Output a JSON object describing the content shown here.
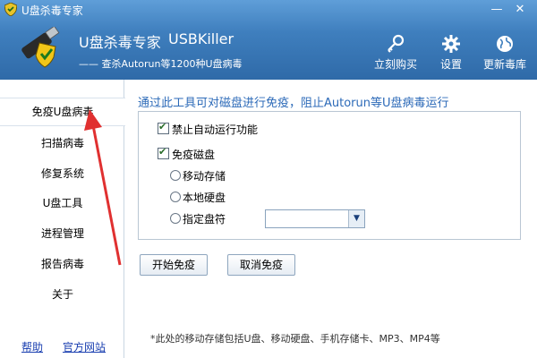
{
  "window": {
    "title": "U盘杀毒专家",
    "minimize": "—",
    "close": "✕"
  },
  "header": {
    "app_name": "U盘杀毒专家",
    "app_name_en": "USBKiller",
    "tagline": "—— 查杀Autorun等1200种U盘病毒",
    "tools": [
      {
        "label": "立刻购买",
        "icon": "key-icon"
      },
      {
        "label": "设置",
        "icon": "gear-icon"
      },
      {
        "label": "更新毒库",
        "icon": "globe-icon"
      }
    ]
  },
  "sidebar": {
    "items": [
      {
        "label": "免疫U盘病毒",
        "selected": true
      },
      {
        "label": "扫描病毒"
      },
      {
        "label": "修复系统"
      },
      {
        "label": "U盘工具"
      },
      {
        "label": "进程管理"
      },
      {
        "label": "报告病毒"
      },
      {
        "label": "关于"
      }
    ],
    "links": {
      "help": "帮助",
      "site": "官方网站"
    }
  },
  "main": {
    "heading": "通过此工具可对磁盘进行免疫，阻止Autorun等U盘病毒运行",
    "options": {
      "disable_autorun": {
        "label": "禁止自动运行功能",
        "checked": true
      },
      "immune_disk": {
        "label": "免疫磁盘",
        "checked": true
      },
      "radios": [
        {
          "label": "移动存储"
        },
        {
          "label": "本地硬盘"
        },
        {
          "label": "指定盘符"
        }
      ],
      "drive_select_value": ""
    },
    "buttons": {
      "start": "开始免疫",
      "cancel": "取消免疫"
    },
    "footnote": "*此处的移动存储包括U盘、移动硬盘、手机存储卡、MP3、MP4等"
  },
  "colors": {
    "header": "#3f7fbe",
    "heading": "#2c6ab8",
    "link": "#1a3fb0",
    "arrow": "#e03030"
  }
}
